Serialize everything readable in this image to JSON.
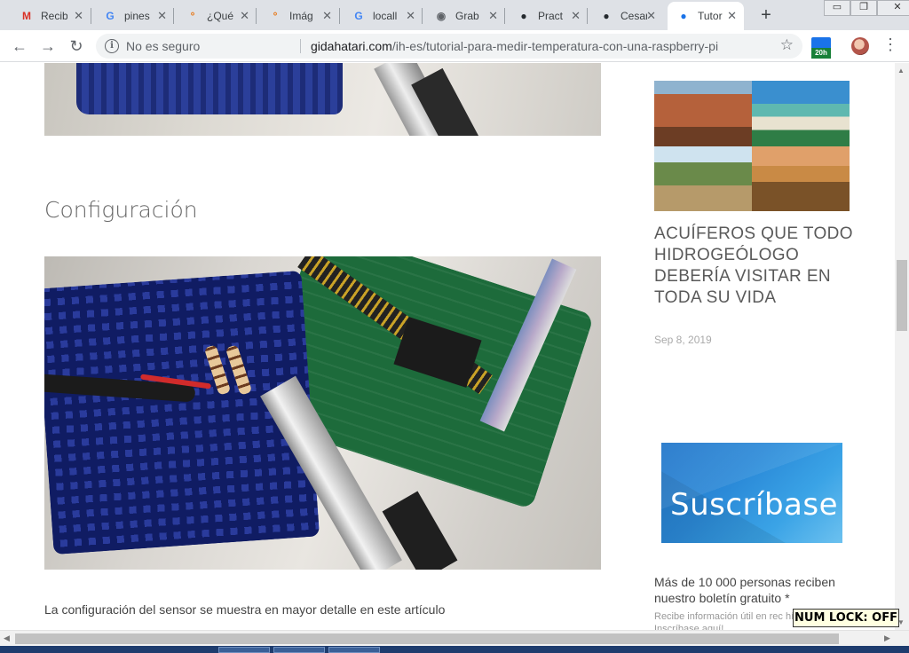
{
  "browser": {
    "tabs": [
      {
        "label": "Recib",
        "icon": "gmail-icon",
        "color": "#d93025",
        "glyph": "M"
      },
      {
        "label": "pines",
        "icon": "google-icon",
        "color": "#4285f4",
        "glyph": "G"
      },
      {
        "label": "¿Qué",
        "icon": "dots-icon",
        "color": "#e8710a",
        "glyph": "°"
      },
      {
        "label": "Imág",
        "icon": "dots-icon",
        "color": "#e8710a",
        "glyph": "°"
      },
      {
        "label": "locall",
        "icon": "google-icon",
        "color": "#4285f4",
        "glyph": "G"
      },
      {
        "label": "Grab",
        "icon": "globe-icon",
        "color": "#5f6368",
        "glyph": "◉"
      },
      {
        "label": "Pract",
        "icon": "github-icon",
        "color": "#24292e",
        "glyph": "●"
      },
      {
        "label": "Cesar",
        "icon": "github-icon",
        "color": "#24292e",
        "glyph": "●"
      },
      {
        "label": "Tutor",
        "icon": "site-icon",
        "color": "#1a73e8",
        "glyph": "●"
      }
    ],
    "close_glyph": "✕",
    "new_tab_glyph": "+",
    "window_buttons": {
      "minimize": "▭",
      "restore": "❐",
      "close": "✕"
    },
    "back_glyph": "←",
    "forward_glyph": "→",
    "reload_glyph": "↻",
    "info_glyph": "i",
    "security_text": "No es seguro",
    "url_host": "gidahatari.com",
    "url_path": "/ih-es/tutorial-para-medir-temperatura-con-una-raspberry-pi",
    "bookmark_glyph": "☆",
    "extension_badge": "20h",
    "menu_glyph": "⋮"
  },
  "article": {
    "section_title": "Configuración",
    "caption": "La configuración del sensor se muestra en mayor detalle en este artículo"
  },
  "sidebar": {
    "post_title": "ACUÍFEROS QUE TODO HIDROGEÓLOGO DEBERÍA VISITAR EN TODA SU VIDA",
    "post_date": "Sep 8, 2019",
    "subscribe_banner": "Suscríbase",
    "newsletter_text": "Más de 10 000 personas reciben nuestro boletín gratuito *",
    "newsletter_small": "Recibe información útil en rec hídricos. Inscríbase aquí!"
  },
  "overlay": {
    "numlock": "NUM LOCK: OFF"
  },
  "scrollbars": {
    "up": "▲",
    "down": "▼",
    "left": "◀",
    "right": "▶"
  }
}
